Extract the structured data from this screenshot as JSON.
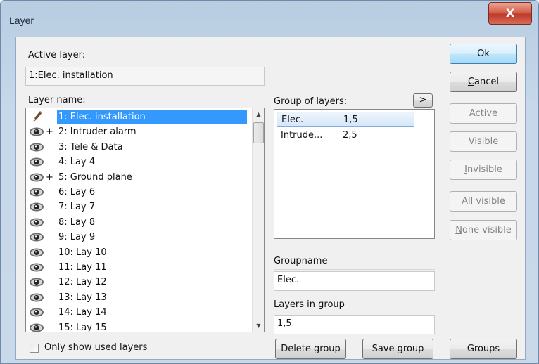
{
  "window": {
    "title": "Layer",
    "close_glyph": "X"
  },
  "active_layer": {
    "label": "Active layer:",
    "value": "1:Elec. installation"
  },
  "layer_name": {
    "label": "Layer name:"
  },
  "layers": [
    {
      "prefix": "+",
      "text": "1: Elec. installation",
      "icon": "pencil-icon",
      "selected": true
    },
    {
      "prefix": "+",
      "text": "2: Intruder alarm",
      "icon": "eye-icon"
    },
    {
      "prefix": "",
      "text": "3: Tele & Data",
      "icon": "eye-icon"
    },
    {
      "prefix": "",
      "text": "4: Lay 4",
      "icon": "eye-icon"
    },
    {
      "prefix": "+",
      "text": "5: Ground plane",
      "icon": "eye-icon"
    },
    {
      "prefix": "",
      "text": "6: Lay 6",
      "icon": "eye-icon"
    },
    {
      "prefix": "",
      "text": "7: Lay 7",
      "icon": "eye-icon"
    },
    {
      "prefix": "",
      "text": "8: Lay 8",
      "icon": "eye-icon"
    },
    {
      "prefix": "",
      "text": "9: Lay 9",
      "icon": "eye-icon"
    },
    {
      "prefix": "",
      "text": "10: Lay 10",
      "icon": "eye-icon"
    },
    {
      "prefix": "",
      "text": "11: Lay 11",
      "icon": "eye-icon"
    },
    {
      "prefix": "",
      "text": "12: Lay 12",
      "icon": "eye-icon"
    },
    {
      "prefix": "",
      "text": "13: Lay 13",
      "icon": "eye-icon"
    },
    {
      "prefix": "",
      "text": "14: Lay 14",
      "icon": "eye-icon"
    },
    {
      "prefix": "",
      "text": "15: Lay 15",
      "icon": "eye-icon"
    }
  ],
  "only_used": {
    "label": "Only show used layers",
    "checked": false
  },
  "group_of_layers": {
    "label": "Group of layers:",
    "expand_label": ">",
    "rows": [
      {
        "name": "Elec.",
        "layers": "1,5",
        "selected": true
      },
      {
        "name": "Intrude...",
        "layers": "2,5",
        "selected": false
      }
    ]
  },
  "groupname": {
    "label": "Groupname",
    "value": "Elec."
  },
  "layers_in_group": {
    "label": "Layers in group",
    "value": "1,5"
  },
  "buttons": {
    "ok": "Ok",
    "cancel": "Cancel",
    "active": "Active",
    "visible": "Visible",
    "invisible": "Invisible",
    "all_visible": "All visible",
    "none_visible": "None visible",
    "delete_group": "Delete group",
    "save_group": "Save group",
    "groups": "Groups"
  },
  "colors": {
    "selection": "#3399ff",
    "default_button": "#bee6fd",
    "close_button": "#c0392b"
  }
}
